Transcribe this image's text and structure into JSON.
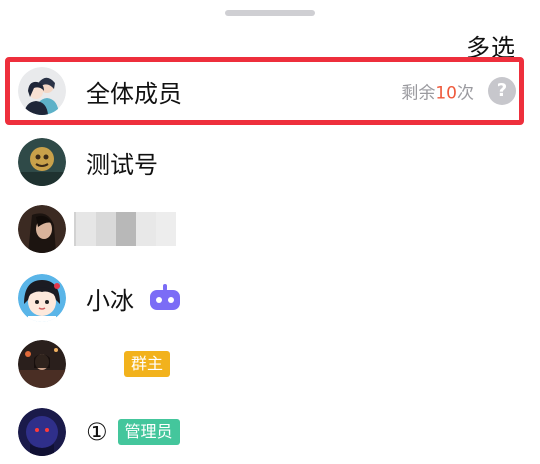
{
  "header": {
    "multi_select_label": "多选"
  },
  "members": {
    "all": {
      "name": "全体成员",
      "remain_prefix": "剩余",
      "remain_count": "10",
      "remain_suffix": "次",
      "help_glyph": "?"
    },
    "row2": {
      "name": "测试号"
    },
    "row4": {
      "name": "小冰"
    },
    "row5": {
      "badge": "群主"
    },
    "row6": {
      "name": "①",
      "badge": "管理员"
    }
  },
  "colors": {
    "highlight": "#ee2f3c",
    "owner_badge": "#f2b21c",
    "admin_badge": "#44c69c",
    "bot_icon": "#7b6cf6",
    "remain_count": "#ef5a3c"
  },
  "icons": {
    "all_members": "group-avatar-icon",
    "help": "question-mark-icon",
    "bot": "robot-icon"
  }
}
